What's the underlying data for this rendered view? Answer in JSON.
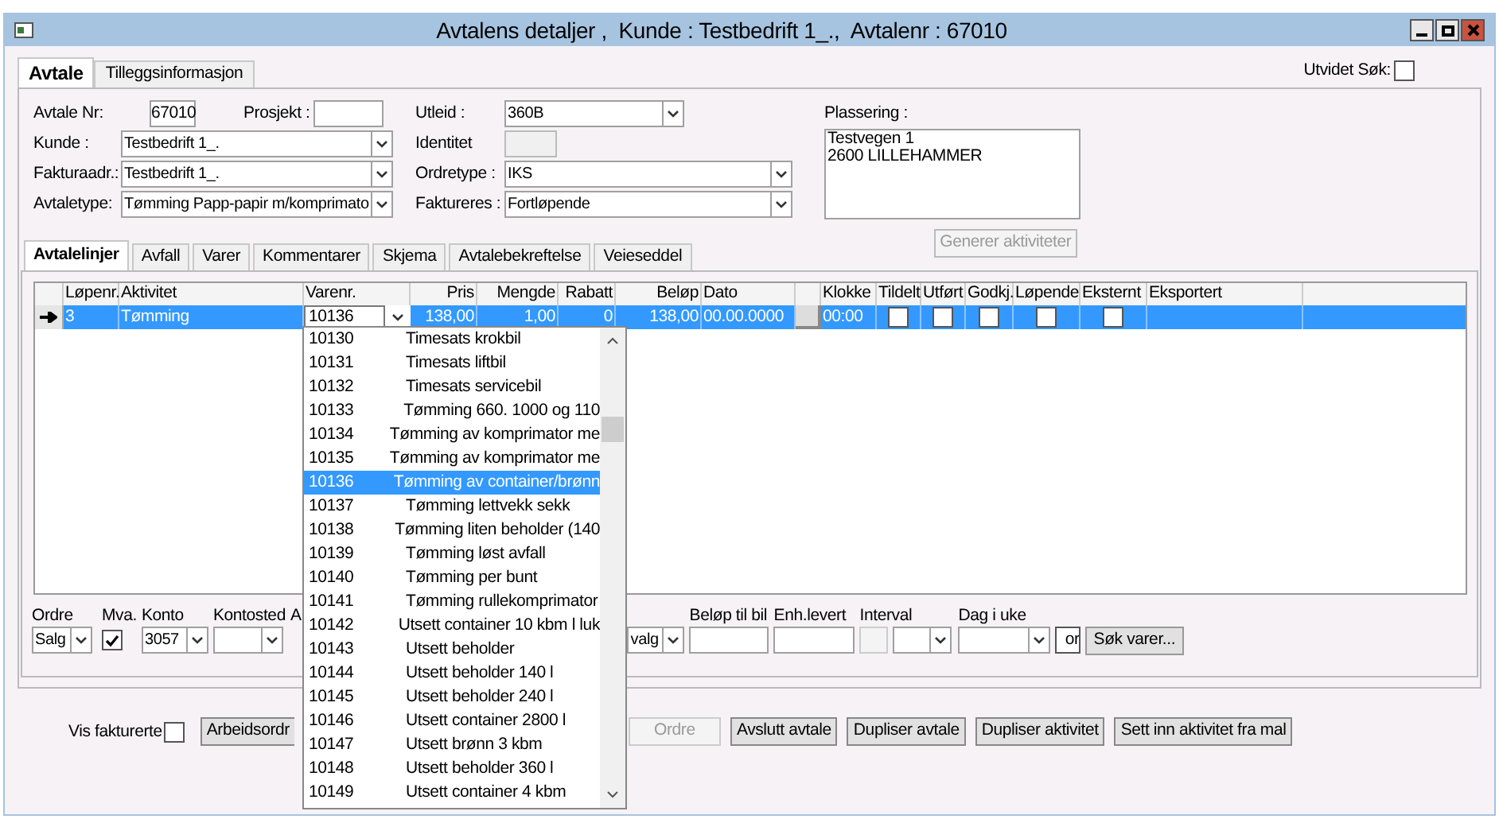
{
  "window": {
    "title": "Avtalens detaljer ,  Kunde : Testbedrift 1_.,  Avtalenr : 67010"
  },
  "tabs": [
    {
      "label": "Avtale",
      "selected": true
    },
    {
      "label": "Tilleggsinformasjon",
      "selected": false
    }
  ],
  "extended_search": {
    "label": "Utvidet Søk:",
    "checked": false
  },
  "agreement_no": {
    "label": "Avtale Nr:",
    "value": "67010"
  },
  "project": {
    "label": "Prosjekt :"
  },
  "left_fields": [
    {
      "label": "Kunde :",
      "value": "Testbedrift 1_."
    },
    {
      "label": "Fakturaadr.:",
      "value": "Testbedrift 1_."
    },
    {
      "label": "Avtaletype:",
      "value": "Tømming Papp-papir m/komprimato"
    }
  ],
  "rented": {
    "label": "Utleid :",
    "value": "360B"
  },
  "identity": {
    "label": "Identitet",
    "disabled": true
  },
  "right_fields": [
    {
      "label": "Ordretype :",
      "value": "IKS"
    },
    {
      "label": "Faktureres :",
      "value": "Fortløpende"
    }
  ],
  "location": {
    "label": "Plassering :",
    "lines": [
      "Testvegen 1",
      "2600 LILLEHAMMER"
    ]
  },
  "generate_button": {
    "label": "Generer aktiviteter",
    "disabled": true
  },
  "subtabs": [
    {
      "label": "Avtalelinjer",
      "selected": true
    },
    {
      "label": "Avfall",
      "selected": false
    },
    {
      "label": "Varer",
      "selected": false
    },
    {
      "label": "Kommentarer",
      "selected": false
    },
    {
      "label": "Skjema",
      "selected": false
    },
    {
      "label": "Avtalebekreftelse",
      "selected": false
    },
    {
      "label": "Veieseddel",
      "selected": false
    }
  ],
  "grid": {
    "columns": [
      {
        "kind": "text",
        "label": "Løpenr."
      },
      {
        "kind": "text",
        "label": "Aktivitet"
      },
      {
        "kind": "combo",
        "label": "Varenr."
      },
      {
        "kind": "number",
        "label": "Pris"
      },
      {
        "kind": "number",
        "label": "Mengde"
      },
      {
        "kind": "number",
        "label": "Rabatt"
      },
      {
        "kind": "number",
        "label": "Beløp"
      },
      {
        "kind": "text",
        "label": "Dato"
      },
      {
        "kind": "blank"
      },
      {
        "kind": "text",
        "label": "Klokke"
      },
      {
        "kind": "check",
        "label": "Tildelt"
      },
      {
        "kind": "check",
        "label": "Utført"
      },
      {
        "kind": "check",
        "label": "Godkj."
      },
      {
        "kind": "check",
        "label": "Løpende"
      },
      {
        "kind": "check",
        "label": "Eksternt"
      },
      {
        "kind": "text",
        "label": "Eksportert"
      }
    ],
    "rows": [
      {
        "selected": true,
        "current": true,
        "cells": [
          {
            "text": "3"
          },
          {
            "text": "Tømming"
          },
          {
            "text": "10136"
          },
          {
            "text": "138,00"
          },
          {
            "text": "1,00"
          },
          {
            "text": "0"
          },
          {
            "text": "138,00"
          },
          {
            "text": "00.00.0000"
          },
          {},
          {
            "text": "00:00"
          },
          {
            "checked": false
          },
          {
            "checked": false
          },
          {
            "checked": false
          },
          {
            "checked": false
          },
          {
            "checked": false
          },
          {}
        ]
      }
    ]
  },
  "dropdown": [
    {
      "code": "10130",
      "name": "Timesats krokbil",
      "selected": false
    },
    {
      "code": "10131",
      "name": "Timesats liftbil",
      "selected": false
    },
    {
      "code": "10132",
      "name": "Timesats servicebil",
      "selected": false
    },
    {
      "code": "10133",
      "name": "Tømming 660. 1000 og 110",
      "selected": false
    },
    {
      "code": "10134",
      "name": "Tømming av komprimator me",
      "selected": false
    },
    {
      "code": "10135",
      "name": "Tømming av komprimator me",
      "selected": false
    },
    {
      "code": "10136",
      "name": "Tømming av container/brønn",
      "selected": true
    },
    {
      "code": "10137",
      "name": "Tømming lettvekk sekk",
      "selected": false
    },
    {
      "code": "10138",
      "name": "Tømming liten beholder (140",
      "selected": false
    },
    {
      "code": "10139",
      "name": "Tømming løst avfall",
      "selected": false
    },
    {
      "code": "10140",
      "name": "Tømming per bunt",
      "selected": false
    },
    {
      "code": "10141",
      "name": "Tømming rullekomprimator",
      "selected": false
    },
    {
      "code": "10142",
      "name": "Utsett container 10 kbm l luk",
      "selected": false
    },
    {
      "code": "10143",
      "name": "Utsett beholder",
      "selected": false
    },
    {
      "code": "10144",
      "name": "Utsett beholder 140 l",
      "selected": false
    },
    {
      "code": "10145",
      "name": "Utsett beholder 240 l",
      "selected": false
    },
    {
      "code": "10146",
      "name": "Utsett container 2800 l",
      "selected": false
    },
    {
      "code": "10147",
      "name": "Utsett brønn 3 kbm",
      "selected": false
    },
    {
      "code": "10148",
      "name": "Utsett beholder 360 l",
      "selected": false
    },
    {
      "code": "10149",
      "name": "Utsett container 4 kbm",
      "selected": false
    }
  ],
  "line_fields": {
    "order": {
      "label": "Ordre",
      "value": "Salg"
    },
    "vat": {
      "label": "Mva.",
      "checked": true
    },
    "account": {
      "label": "Konto",
      "value": "3057"
    },
    "cost_center": {
      "label": "Kontosted"
    },
    "column_5": {
      "label": "A"
    },
    "column_6": {
      "value": "valg"
    },
    "amount_to_vehicle": {
      "label": "Beløp til bil"
    },
    "units_delivered": {
      "label": "Enh.levert"
    },
    "interval": {
      "label": "Interval"
    },
    "weekday": {
      "label": "Dag i uke"
    },
    "column_11": {
      "value": "or"
    },
    "search_button": {
      "label": "Søk varer..."
    }
  },
  "show_invoiced": {
    "label": "Vis fakturerte",
    "checked": false
  },
  "buttons": [
    {
      "label": "Arbeidsordr",
      "disabled": false,
      "cut": true
    },
    {
      "label": "Ordre",
      "disabled": true
    },
    {
      "label": "Avslutt avtale",
      "disabled": false
    },
    {
      "label": "Dupliser avtale",
      "disabled": false
    },
    {
      "label": "Dupliser aktivitet",
      "disabled": false
    },
    {
      "label": "Sett inn aktivitet fra mal",
      "disabled": false
    }
  ]
}
